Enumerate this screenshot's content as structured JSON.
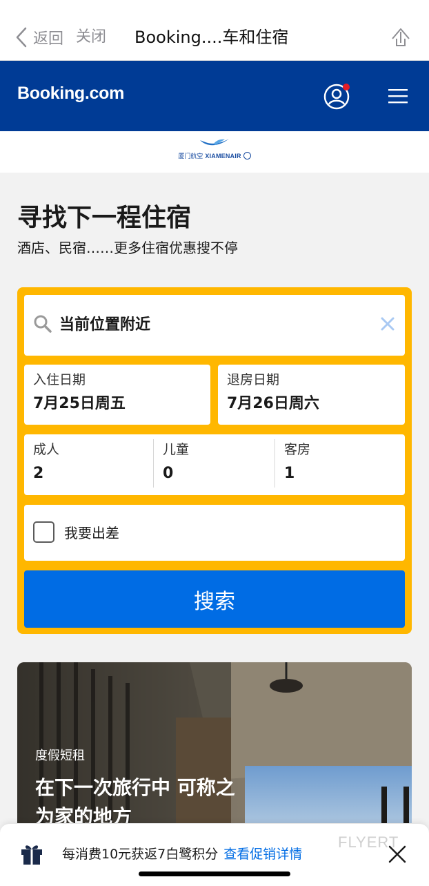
{
  "webview": {
    "back_label": "返回",
    "close_label": "关闭",
    "title": "Booking....车和住宿"
  },
  "header": {
    "logo_text": "Booking.com",
    "brand_color": "#003b95",
    "notification_color": "#e21c25"
  },
  "partner": {
    "logo_cn": "厦门航空",
    "logo_en": "XIAMENAIR"
  },
  "hero": {
    "title": "寻找下一程住宿",
    "subtitle": "酒店、民宿……更多住宿优惠搜不停"
  },
  "search": {
    "destination": "当前位置附近",
    "checkin_label": "入住日期",
    "checkin_value": "7月25日周五",
    "checkout_label": "退房日期",
    "checkout_value": "7月26日周六",
    "adults_label": "成人",
    "adults_value": "2",
    "children_label": "儿童",
    "children_value": "0",
    "rooms_label": "客房",
    "rooms_value": "1",
    "business_trip_label": "我要出差",
    "business_trip_checked": false,
    "button_label": "搜索",
    "box_color": "#ffb700",
    "button_color": "#006ce4"
  },
  "promo": {
    "tag": "度假短租",
    "title": "在下一次旅行中 可称之为家的地方"
  },
  "banner": {
    "text": "每消费10元获返7白鹭积分",
    "link": "查看促销详情",
    "watermark": "FLYERT"
  },
  "icons": [
    "chevron-left-icon",
    "share-icon",
    "account-icon",
    "menu-icon",
    "search-icon",
    "clear-icon",
    "gift-icon",
    "close-icon"
  ]
}
